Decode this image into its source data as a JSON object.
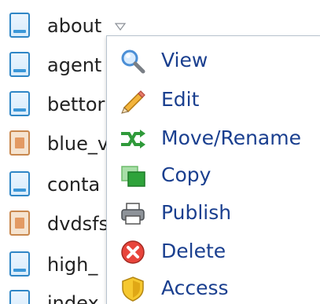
{
  "files": [
    {
      "name": "about",
      "icon": "document-icon",
      "type": "doc"
    },
    {
      "name": "agent",
      "icon": "document-icon",
      "type": "doc"
    },
    {
      "name": "bettor",
      "icon": "document-icon",
      "type": "doc"
    },
    {
      "name": "blue_v",
      "icon": "image-icon",
      "type": "img"
    },
    {
      "name": "conta",
      "icon": "document-icon",
      "type": "doc"
    },
    {
      "name": "dvdsfs",
      "icon": "image-icon",
      "type": "img"
    },
    {
      "name": "high_",
      "icon": "document-icon",
      "type": "doc"
    },
    {
      "name": "index",
      "icon": "document-icon",
      "type": "doc"
    }
  ],
  "context_menu": {
    "items": [
      {
        "label": "View",
        "icon": "magnifier-icon"
      },
      {
        "label": "Edit",
        "icon": "pencil-icon"
      },
      {
        "label": "Move/Rename",
        "icon": "shuffle-icon"
      },
      {
        "label": "Copy",
        "icon": "copy-icon"
      },
      {
        "label": "Publish",
        "icon": "printer-icon"
      },
      {
        "label": "Delete",
        "icon": "delete-icon"
      },
      {
        "label": "Access",
        "icon": "shield-icon"
      }
    ]
  },
  "colors": {
    "menu_text": "#1a3f8f",
    "doc_icon": "#2f86c6",
    "image_icon": "#c9884e"
  }
}
